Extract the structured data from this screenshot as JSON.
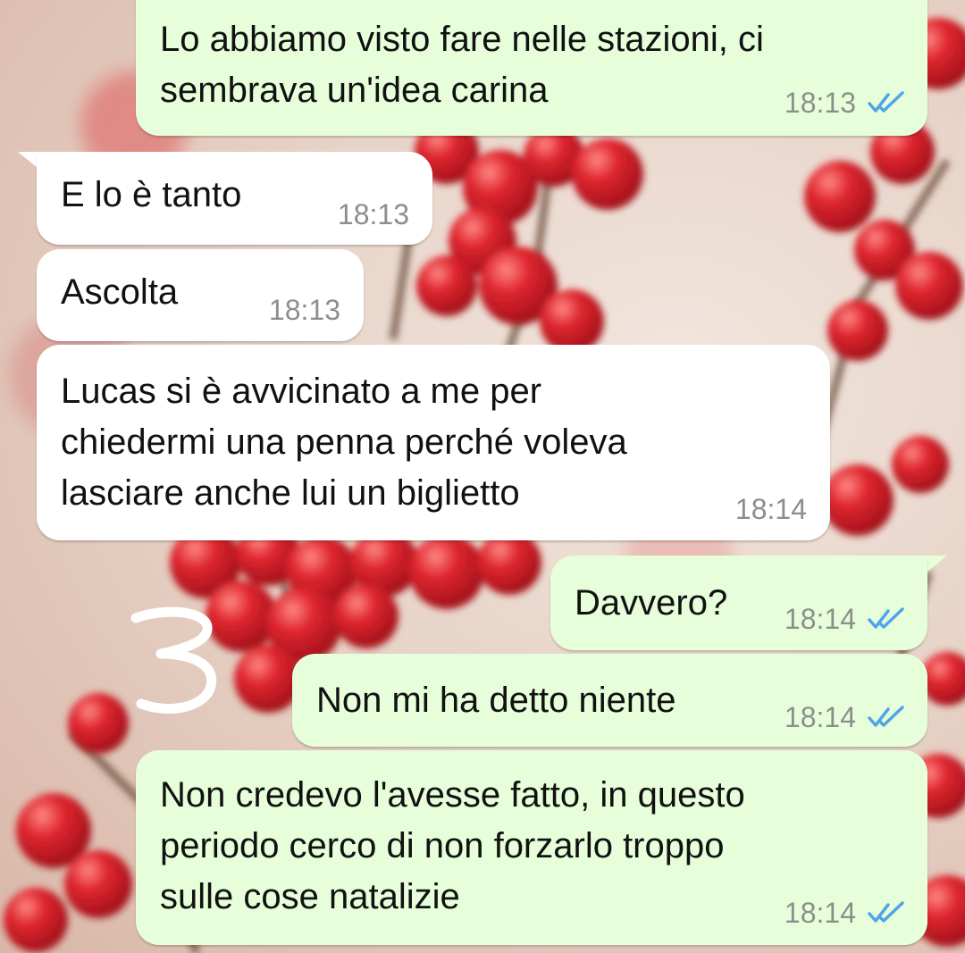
{
  "messages": [
    {
      "direction": "out",
      "lines": "Lo abbiamo visto fare nelle stazioni, ci\nsembrava un'idea carina",
      "time": "18:13",
      "status": "read"
    },
    {
      "direction": "in",
      "lines": "E lo è tanto",
      "time": "18:13"
    },
    {
      "direction": "in",
      "lines": "Ascolta",
      "time": "18:13"
    },
    {
      "direction": "in",
      "lines": "Lucas si è avvicinato a me per\nchiedermi una penna perché voleva\nlasciare anche lui un biglietto",
      "time": "18:14"
    },
    {
      "direction": "out",
      "lines": "Davvero?",
      "time": "18:14",
      "status": "read"
    },
    {
      "direction": "out",
      "lines": "Non mi ha detto niente",
      "time": "18:14",
      "status": "read"
    },
    {
      "direction": "out",
      "lines": "Non credevo l'avesse fatto, in questo\nperiodo cerco di non forzarlo troppo\nsulle cose natalizie",
      "time": "18:14",
      "status": "read"
    }
  ],
  "annotation": {
    "text": "3"
  },
  "colors": {
    "outgoing_bubble": "#e6ffda",
    "incoming_bubble": "#ffffff",
    "read_check": "#4fa6e6",
    "timestamp": "#8a8f8c",
    "berries": "#d8202a"
  },
  "icons": {
    "read_receipt": "double-check-icon"
  }
}
